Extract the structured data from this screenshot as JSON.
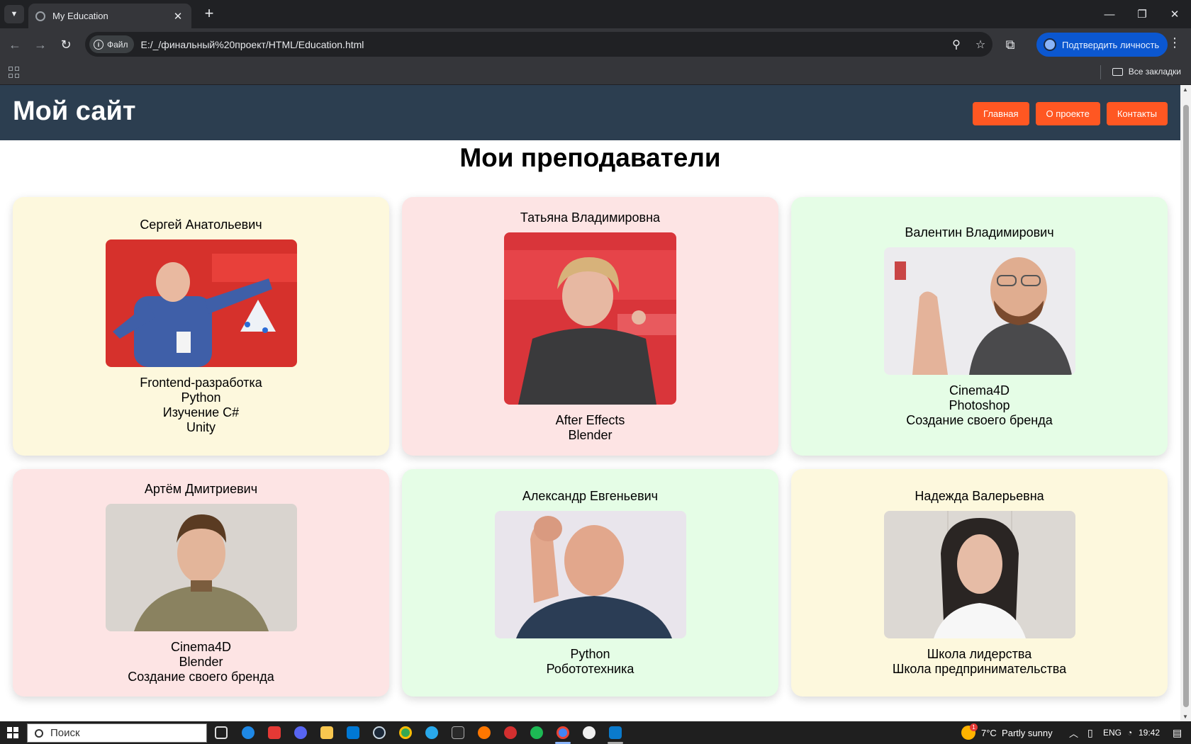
{
  "browser": {
    "tab_title": "My Education",
    "tab_close": "✕",
    "new_tab": "+",
    "site_info_label": "Файл",
    "url": "E:/_/финальный%20проект/HTML/Education.html",
    "verify_label": "Подтвердить личность",
    "all_bookmarks": "Все закладки"
  },
  "site": {
    "title": "Мой сайт",
    "nav": [
      "Главная",
      "О проекте",
      "Контакты"
    ],
    "heading": "Мои преподаватели"
  },
  "teachers": [
    {
      "name": "Сергей Анатольевич",
      "courses": [
        "Frontend-разработка",
        "Python",
        "Изучение C#",
        "Unity"
      ],
      "card_color": "#fdf8dd"
    },
    {
      "name": "Татьяна Владимировна",
      "courses": [
        "After Effects",
        "Blender"
      ],
      "card_color": "#fde4e4"
    },
    {
      "name": "Валентин Владимирович",
      "courses": [
        "Cinema4D",
        "Photoshop",
        "Создание своего бренда"
      ],
      "card_color": "#e5fde6"
    },
    {
      "name": "Артём Дмитриевич",
      "courses": [
        "Cinema4D",
        "Blender",
        "Создание своего бренда"
      ],
      "card_color": "#fde4e4"
    },
    {
      "name": "Александр Евгеньевич",
      "courses": [
        "Python",
        "Робототехника"
      ],
      "card_color": "#e5fde6"
    },
    {
      "name": "Надежда Валерьевна",
      "courses": [
        "Школа лидерства",
        "Школа предпринимательства"
      ],
      "card_color": "#fdf8dd"
    }
  ],
  "taskbar": {
    "search_placeholder": "Поиск",
    "weather": "7°C  Partly sunny",
    "weather_badge": "1",
    "language": "ENG",
    "time": "19:42"
  },
  "colors": {
    "header_bg": "#2c3e50",
    "nav_button": "#ff5722"
  }
}
